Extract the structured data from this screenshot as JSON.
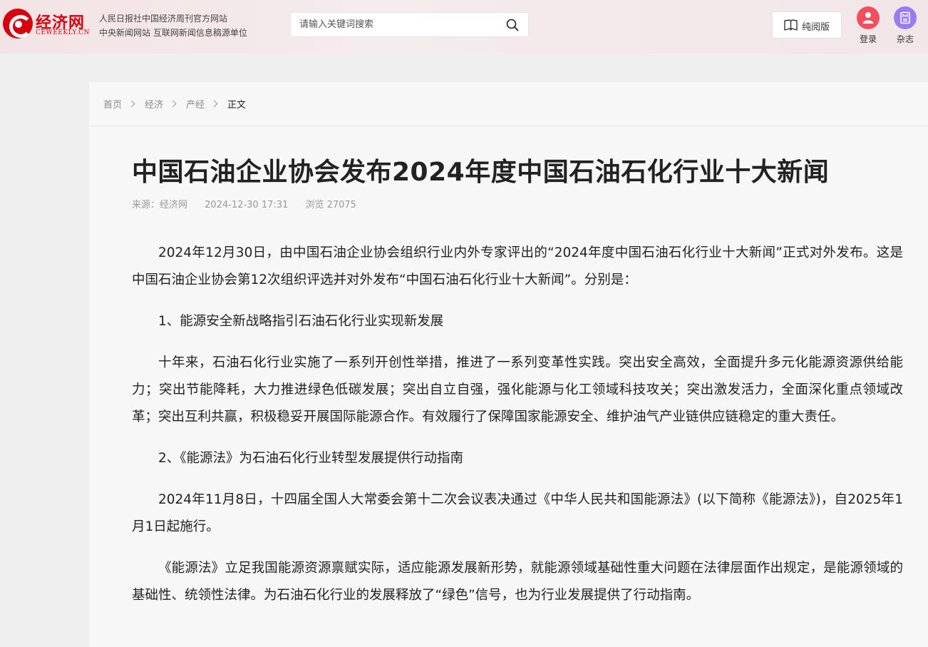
{
  "header": {
    "logo_text": "经济网",
    "logo_en": "CEWEEKLY.CN",
    "slogan_line1": "人民日报社中国经济周刊官方网站",
    "slogan_line2": "中央新闻网站 互联网新闻信息稿源单位",
    "search_placeholder": "请输入关键词搜索",
    "reader_label": "纯阅版",
    "login_label": "登录",
    "magazine_label": "杂志"
  },
  "breadcrumb": {
    "items": [
      "首页",
      "经济",
      "产经"
    ],
    "current": "正文"
  },
  "article": {
    "title": "中国石油企业协会发布2024年度中国石油石化行业十大新闻",
    "source": "来源：经济网",
    "datetime": "2024-12-30 17:31",
    "views": "浏览 27075",
    "paragraphs": [
      "2024年12月30日，由中国石油企业协会组织行业内外专家评出的“2024年度中国石油石化行业十大新闻”正式对外发布。这是中国石油企业协会第12次组织评选并对外发布“中国石油石化行业十大新闻”。分别是：",
      "1、能源安全新战略指引石油石化行业实现新发展",
      "十年来，石油石化行业实施了一系列开创性举措，推进了一系列变革性实践。突出安全高效，全面提升多元化能源资源供给能力；突出节能降耗，大力推进绿色低碳发展；突出自立自强，强化能源与化工领域科技攻关；突出激发活力，全面深化重点领域改革；突出互利共赢，积极稳妥开展国际能源合作。有效履行了保障国家能源安全、维护油气产业链供应链稳定的重大责任。",
      "2、《能源法》为石油石化行业转型发展提供行动指南",
      "2024年11月8日，十四届全国人大常委会第十二次会议表决通过《中华人民共和国能源法》(以下简称《能源法》)，自2025年1月1日起施行。",
      "《能源法》立足我国能源资源禀赋实际，适应能源发展新形势，就能源领域基础性重大问题在法律层面作出规定，是能源领域的基础性、统领性法律。为石油石化行业的发展释放了“绿色”信号，也为行业发展提供了行动指南。"
    ]
  },
  "colors": {
    "brand_red": "#d7000f",
    "login_red": "#f24e5e",
    "magazine_purple": "#9a7cf0"
  }
}
